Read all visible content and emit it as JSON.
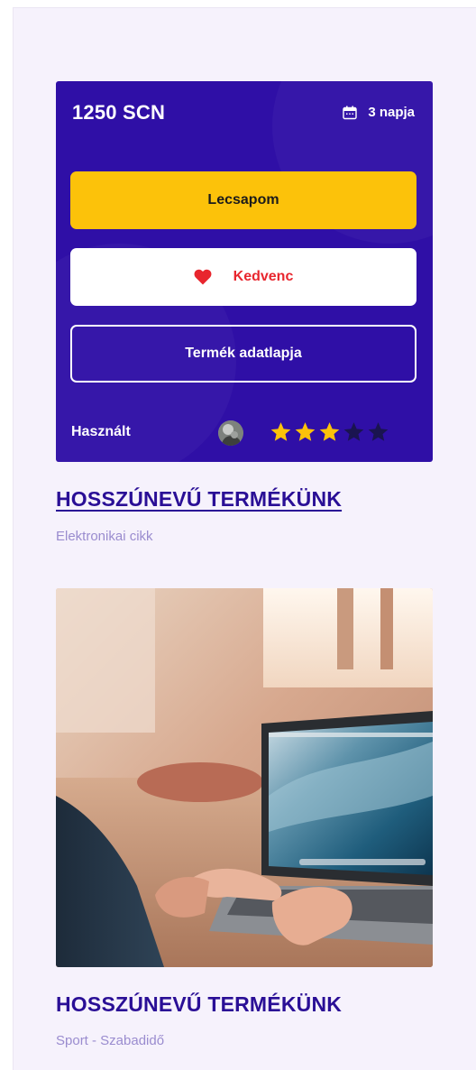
{
  "promo_card": {
    "price": "1250 SCN",
    "days_left": "3 napja",
    "grab_label": "Lecsapom",
    "favorite_label": "Kedvenc",
    "details_label": "Termék adatlapja",
    "condition": "Használt",
    "rating": 3,
    "rating_max": 5,
    "colors": {
      "card_bg": "#2f0fa6",
      "grab_bg": "#fcc20a",
      "favorite_text": "#e8262e",
      "star_on": "#fcc20a",
      "star_off": "#1a1450"
    }
  },
  "products": [
    {
      "title": "HOSSZÚNEVŰ TERMÉKÜNK",
      "category": "Elektronikai cikk"
    },
    {
      "title": "HOSSZÚNEVŰ TERMÉKÜNK",
      "category": "Sport - Szabadidő"
    }
  ],
  "icons": {
    "calendar": "calendar-icon",
    "heart": "heart-icon",
    "star": "star-icon"
  }
}
